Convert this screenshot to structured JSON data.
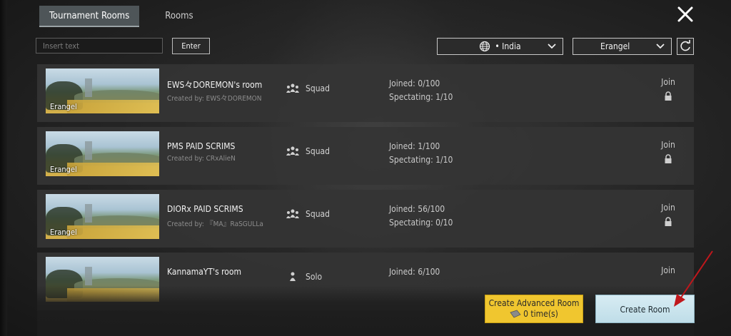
{
  "tabs": [
    {
      "label": "Tournament Rooms"
    },
    {
      "label": "Rooms"
    }
  ],
  "search": {
    "placeholder": "Insert text",
    "enter_label": "Enter"
  },
  "filters": {
    "region": "• India",
    "map": "Erangel"
  },
  "rooms": [
    {
      "name": "EWS々DOREMON's room",
      "creator": "Created by: EWS々DOREMON",
      "mode": "Squad",
      "joined": "Joined: 0/100",
      "spectating": "Spectating: 1/10",
      "join_label": "Join",
      "map": "Erangel"
    },
    {
      "name": "PMS PAID SCRIMS",
      "creator": "Created by: CRxAlieN",
      "mode": "Squad",
      "joined": "Joined: 1/100",
      "spectating": "Spectating: 1/10",
      "join_label": "Join",
      "map": "Erangel"
    },
    {
      "name": "DIORx PAID SCRIMS",
      "creator": "Created by: 『MA』RaSGULLa",
      "mode": "Squad",
      "joined": "Joined: 56/100",
      "spectating": "Spectating: 0/10",
      "join_label": "Join",
      "map": "Erangel"
    },
    {
      "name": "KannamaYT's room",
      "creator": "",
      "mode": "Solo",
      "joined": "Joined: 6/100",
      "spectating": "",
      "join_label": "Join",
      "map": ""
    }
  ],
  "actions": {
    "advanced_line1": "Create Advanced Room",
    "advanced_line2": "0 time(s)",
    "create": "Create Room"
  },
  "colors": {
    "accent_yellow": "#f0c62f",
    "create_button": "#cfe7ef",
    "arrow": "#c0171c"
  },
  "icons": [
    "close-icon",
    "globe-icon",
    "chevron-down-icon",
    "refresh-icon",
    "squad-icon",
    "solo-icon",
    "lock-icon",
    "ticket-icon",
    "arrow-pointer"
  ]
}
